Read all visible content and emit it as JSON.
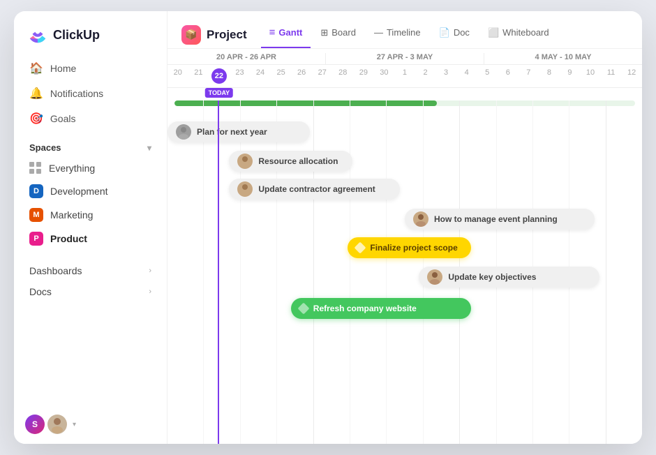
{
  "app": {
    "name": "ClickUp"
  },
  "sidebar": {
    "nav": [
      {
        "id": "home",
        "label": "Home",
        "icon": "🏠"
      },
      {
        "id": "notifications",
        "label": "Notifications",
        "icon": "🔔"
      },
      {
        "id": "goals",
        "label": "Goals",
        "icon": "🎯"
      }
    ],
    "spaces_title": "Spaces",
    "spaces": [
      {
        "id": "everything",
        "label": "Everything",
        "color": null
      },
      {
        "id": "development",
        "label": "Development",
        "color": "#1565C0",
        "letter": "D"
      },
      {
        "id": "marketing",
        "label": "Marketing",
        "color": "#e65100",
        "letter": "M"
      },
      {
        "id": "product",
        "label": "Product",
        "color": "#e91e8c",
        "letter": "P"
      }
    ],
    "sections": [
      {
        "id": "dashboards",
        "label": "Dashboards"
      },
      {
        "id": "docs",
        "label": "Docs"
      }
    ],
    "bottom_chevron": "▾"
  },
  "header": {
    "project_title": "Project",
    "tabs": [
      {
        "id": "gantt",
        "label": "Gantt",
        "icon": "≡",
        "active": true
      },
      {
        "id": "board",
        "label": "Board",
        "icon": "⊞"
      },
      {
        "id": "timeline",
        "label": "Timeline",
        "icon": "—"
      },
      {
        "id": "doc",
        "label": "Doc",
        "icon": "📄"
      },
      {
        "id": "whiteboard",
        "label": "Whiteboard",
        "icon": "⬜"
      }
    ]
  },
  "gantt": {
    "date_groups": [
      {
        "label": "20 APR - 26 APR",
        "span": 7
      },
      {
        "label": "27 APR - 3 MAY",
        "span": 7
      },
      {
        "label": "4 MAY - 10 MAY",
        "span": 7
      }
    ],
    "days": [
      20,
      21,
      22,
      23,
      24,
      25,
      26,
      27,
      28,
      29,
      30,
      1,
      2,
      3,
      4,
      5,
      6,
      7,
      8,
      9,
      10,
      11,
      12
    ],
    "today_label": "TODAY",
    "today_day": "22",
    "tasks": [
      {
        "id": "plan",
        "label": "Plan for next year",
        "type": "gray",
        "left_pct": 3,
        "width_pct": 23
      },
      {
        "id": "resource",
        "label": "Resource allocation",
        "type": "gray",
        "left_pct": 11,
        "width_pct": 20
      },
      {
        "id": "contractor",
        "label": "Update contractor agreement",
        "type": "gray",
        "left_pct": 11,
        "width_pct": 28
      },
      {
        "id": "event_planning",
        "label": "How to manage event planning",
        "type": "gray",
        "left_pct": 48,
        "width_pct": 30
      },
      {
        "id": "finalize",
        "label": "Finalize project scope",
        "type": "yellow",
        "left_pct": 38,
        "width_pct": 22
      },
      {
        "id": "key_obj",
        "label": "Update key objectives",
        "type": "gray",
        "left_pct": 52,
        "width_pct": 30
      },
      {
        "id": "refresh",
        "label": "Refresh company website",
        "type": "green",
        "left_pct": 28,
        "width_pct": 30
      }
    ]
  }
}
